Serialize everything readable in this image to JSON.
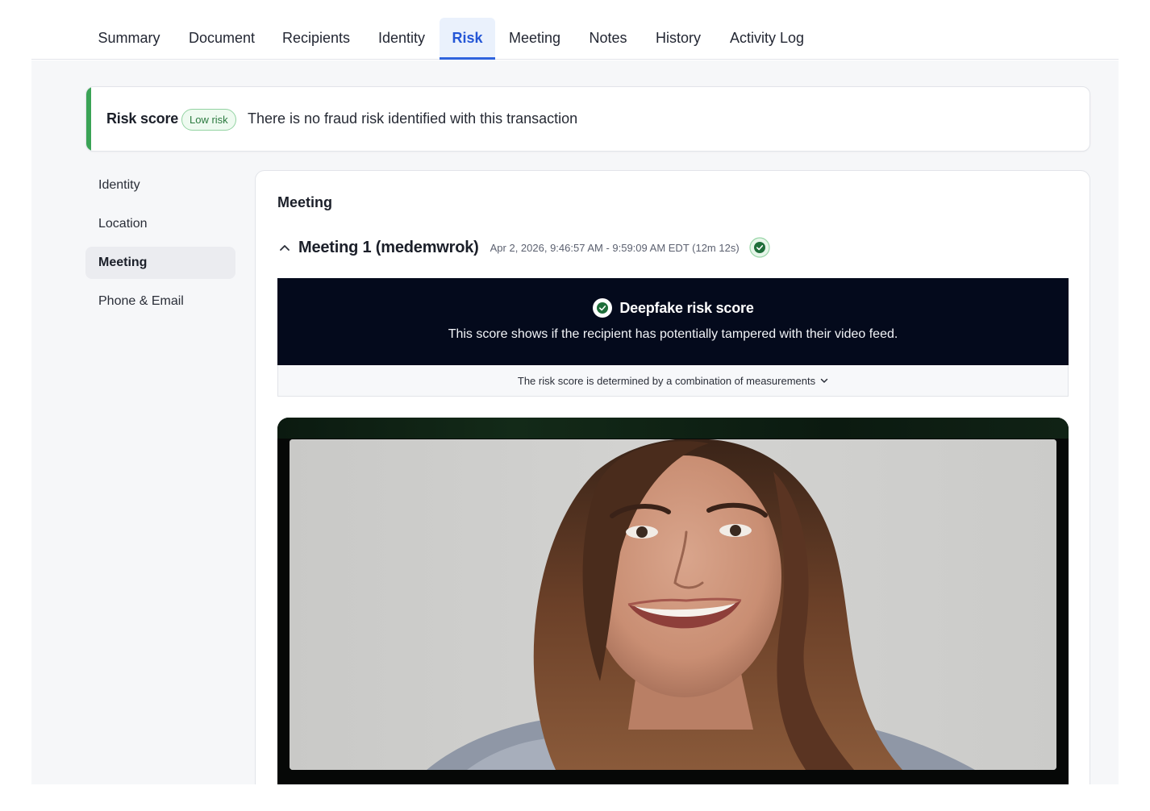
{
  "tabs": [
    {
      "label": "Summary",
      "active": false
    },
    {
      "label": "Document",
      "active": false
    },
    {
      "label": "Recipients",
      "active": false
    },
    {
      "label": "Identity",
      "active": false
    },
    {
      "label": "Risk",
      "active": true
    },
    {
      "label": "Meeting",
      "active": false
    },
    {
      "label": "Notes",
      "active": false
    },
    {
      "label": "History",
      "active": false
    },
    {
      "label": "Activity Log",
      "active": false
    }
  ],
  "risk": {
    "title": "Risk score",
    "badge": "Low risk",
    "message": "There is no fraud risk identified with this transaction"
  },
  "subnav": [
    {
      "label": "Identity",
      "active": false
    },
    {
      "label": "Location",
      "active": false
    },
    {
      "label": "Meeting",
      "active": true
    },
    {
      "label": "Phone & Email",
      "active": false
    }
  ],
  "meeting": {
    "section_title": "Meeting",
    "name": "Meeting 1 (medemwrok)",
    "time": "Apr 2, 2026, 9:46:57 AM - 9:59:09 AM EDT (12m 12s)",
    "status_icon": "check-circle-icon"
  },
  "deepfake": {
    "title": "Deepfake risk score",
    "description": "This score shows if the recipient has potentially tampered with their video feed.",
    "measurements_label": "The risk score is determined by a combination of measurements",
    "icon": "check-circle-icon"
  },
  "colors": {
    "accent_green": "#3aa356",
    "active_tab": "#2e63dd",
    "panel_dark": "#040a1c"
  }
}
